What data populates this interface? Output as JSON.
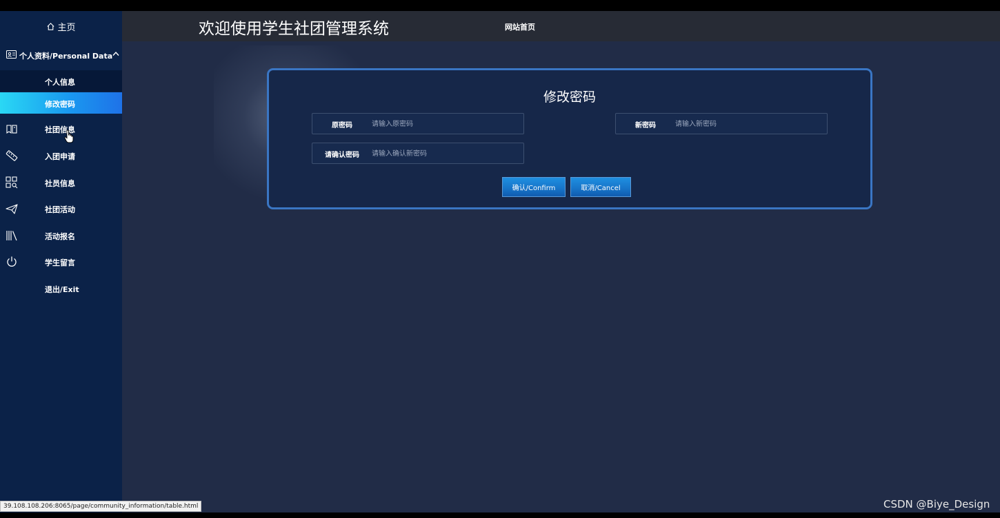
{
  "sidebar": {
    "home_label": "主页",
    "group_label": "个人资料/Personal Data",
    "sub_items": [
      "个人信息",
      "修改密码"
    ],
    "nav_items": [
      {
        "label": "社团信息",
        "icon": "bookmark-icon"
      },
      {
        "label": "入团申请",
        "icon": "ruler-icon"
      },
      {
        "label": "社员信息",
        "icon": "grid-search-icon"
      },
      {
        "label": "社团活动",
        "icon": "paper-plane-icon"
      },
      {
        "label": "活动报名",
        "icon": "library-icon"
      },
      {
        "label": "学生留言",
        "icon": "power-icon"
      },
      {
        "label": "退出/Exit",
        "icon": ""
      }
    ],
    "active_sub_index": 1
  },
  "header": {
    "title": "欢迎使用学生社团管理系统",
    "site_link": "网站首页"
  },
  "form": {
    "title": "修改密码",
    "fields": [
      {
        "label": "原密码",
        "placeholder": "请输入原密码"
      },
      {
        "label": "新密码",
        "placeholder": "请输入新密码"
      },
      {
        "label": "请确认密码",
        "placeholder": "请输入确认新密码"
      }
    ],
    "confirm_label": "确认/Confirm",
    "cancel_label": "取消/Cancel"
  },
  "status_url": "39.108.108.206:8065/page/community_information/table.html",
  "watermark": "CSDN @Biye_Design",
  "colors": {
    "sidebar_bg": "#0b2248",
    "active_gradient_start": "#2ad8f4",
    "active_gradient_end": "#1e72e8",
    "content_bg": "#212c47",
    "card_border": "#3a76c4",
    "button": "#1878cc"
  }
}
